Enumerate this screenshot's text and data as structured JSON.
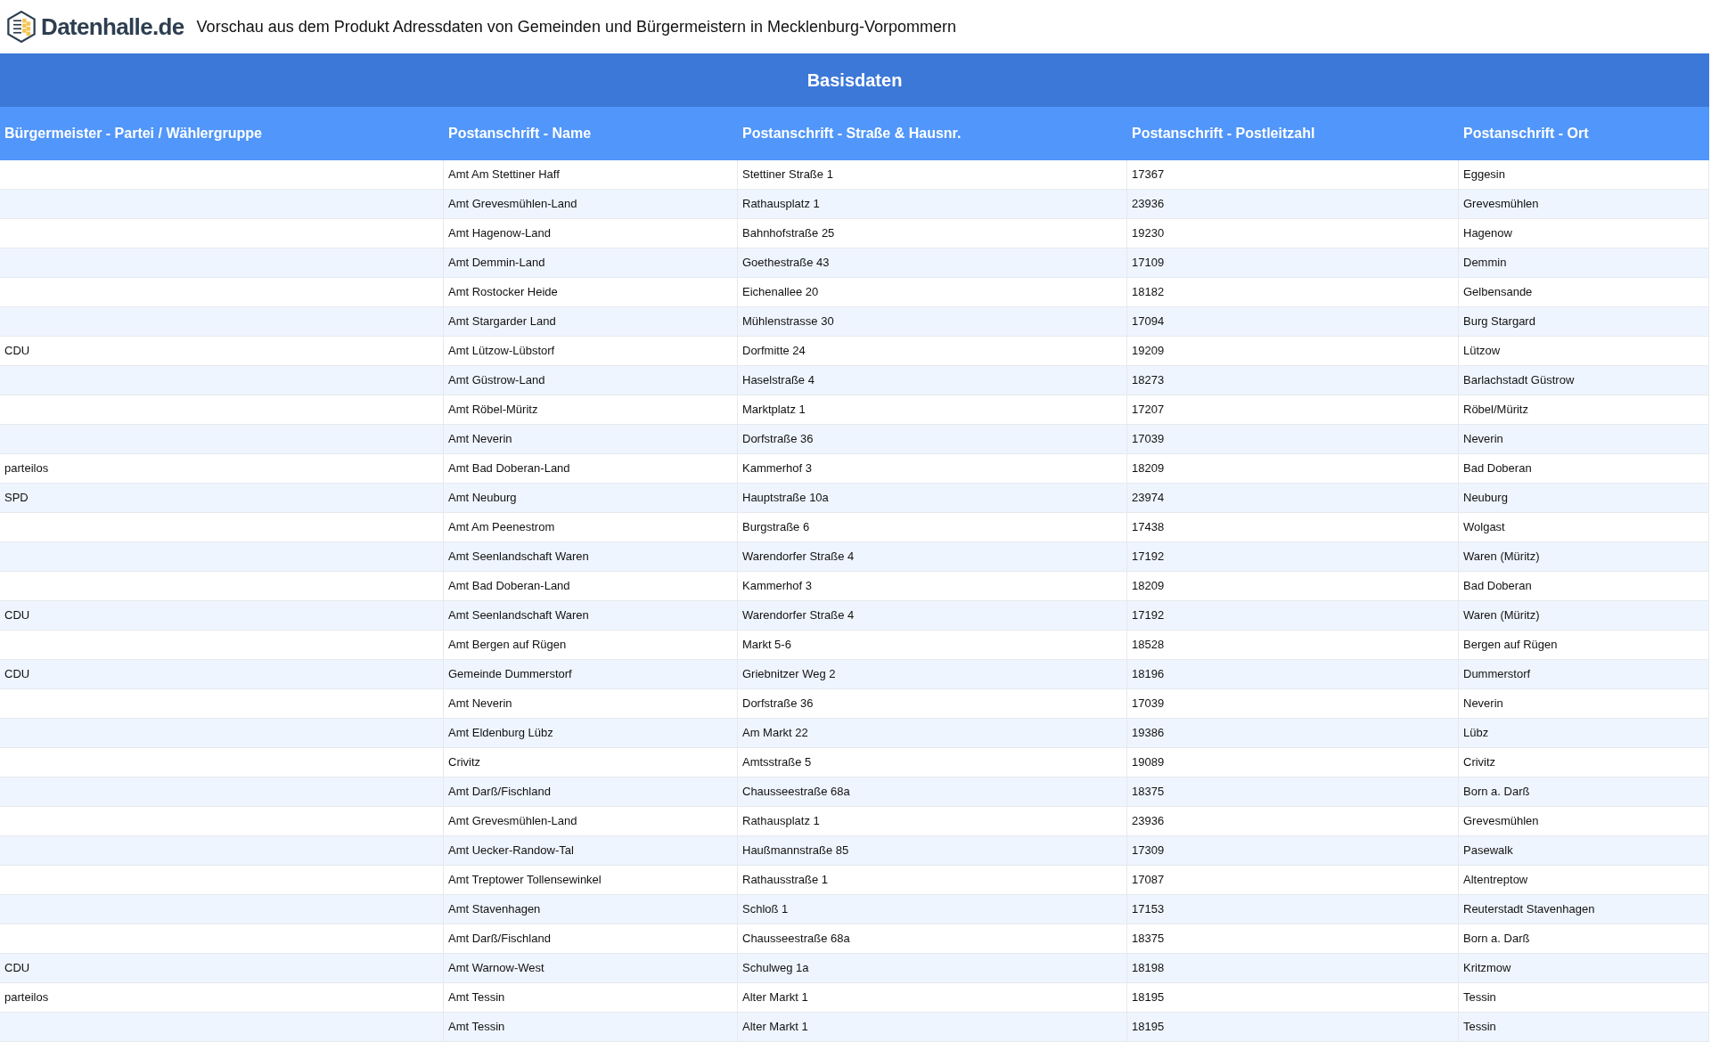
{
  "header": {
    "logo_text": "Datenhalle.de",
    "title": "Vorschau aus dem Produkt Adressdaten von Gemeinden und Bürgermeistern in Mecklenburg-Vorpommern"
  },
  "table": {
    "group_heading": "Basisdaten",
    "columns": [
      "Bürgermeister - Partei / Wählergruppe",
      "Postanschrift - Name",
      "Postanschrift - Straße & Hausnr.",
      "Postanschrift - Postleitzahl",
      "Postanschrift - Ort"
    ],
    "rows": [
      {
        "name": "Amt Am Stettiner Haff",
        "street": "Stettiner Straße 1",
        "zip": "17367",
        "city": "Eggesin"
      },
      {
        "name": "Amt Grevesmühlen-Land",
        "street": "Rathausplatz 1",
        "zip": "23936",
        "city": "Grevesmühlen"
      },
      {
        "name": "Amt Hagenow-Land",
        "street": "Bahnhofstraße 25",
        "zip": "19230",
        "city": "Hagenow"
      },
      {
        "name": "Amt Demmin-Land",
        "street": "Goethestraße 43",
        "zip": "17109",
        "city": "Demmin"
      },
      {
        "name": "Amt Rostocker Heide",
        "street": "Eichenallee 20",
        "zip": "18182",
        "city": "Gelbensande"
      },
      {
        "name": "Amt Stargarder Land",
        "street": "Mühlenstrasse 30",
        "zip": "17094",
        "city": "Burg Stargard"
      },
      {
        "party": "CDU",
        "name": "Amt Lützow-Lübstorf",
        "street": "Dorfmitte 24",
        "zip": "19209",
        "city": "Lützow"
      },
      {
        "name": "Amt Güstrow-Land",
        "street": "Haselstraße 4",
        "zip": "18273",
        "city": "Barlachstadt Güstrow"
      },
      {
        "name": "Amt Röbel-Müritz",
        "street": "Marktplatz 1",
        "zip": "17207",
        "city": "Röbel/Müritz"
      },
      {
        "name": "Amt Neverin",
        "street": "Dorfstraße 36",
        "zip": "17039",
        "city": "Neverin"
      },
      {
        "party": "parteilos",
        "name": "Amt Bad Doberan-Land",
        "street": "Kammerhof 3",
        "zip": "18209",
        "city": "Bad Doberan"
      },
      {
        "party": "SPD",
        "name": "Amt Neuburg",
        "street": "Hauptstraße 10a",
        "zip": "23974",
        "city": "Neuburg"
      },
      {
        "name": "Amt Am Peenestrom",
        "street": "Burgstraße 6",
        "zip": "17438",
        "city": "Wolgast"
      },
      {
        "name": "Amt Seenlandschaft Waren",
        "street": "Warendorfer Straße 4",
        "zip": "17192",
        "city": "Waren (Müritz)"
      },
      {
        "name": "Amt Bad Doberan-Land",
        "street": "Kammerhof 3",
        "zip": "18209",
        "city": "Bad Doberan"
      },
      {
        "party": "CDU",
        "name": "Amt Seenlandschaft Waren",
        "street": "Warendorfer Straße 4",
        "zip": "17192",
        "city": "Waren (Müritz)"
      },
      {
        "name": "Amt Bergen auf Rügen",
        "street": "Markt 5-6",
        "zip": "18528",
        "city": "Bergen auf Rügen"
      },
      {
        "party": "CDU",
        "name": "Gemeinde Dummerstorf",
        "street": "Griebnitzer Weg 2",
        "zip": "18196",
        "city": "Dummerstorf"
      },
      {
        "name": "Amt Neverin",
        "street": "Dorfstraße 36",
        "zip": "17039",
        "city": "Neverin"
      },
      {
        "name": "Amt Eldenburg Lübz",
        "street": "Am Markt 22",
        "zip": "19386",
        "city": "Lübz"
      },
      {
        "name": "Crivitz",
        "street": "Amtsstraße 5",
        "zip": "19089",
        "city": "Crivitz"
      },
      {
        "name": "Amt Darß/Fischland",
        "street": "Chausseestraße 68a",
        "zip": "18375",
        "city": "Born a. Darß"
      },
      {
        "name": "Amt Grevesmühlen-Land",
        "street": "Rathausplatz 1",
        "zip": "23936",
        "city": "Grevesmühlen"
      },
      {
        "name": "Amt Uecker-Randow-Tal",
        "street": "Haußmannstraße 85",
        "zip": "17309",
        "city": "Pasewalk"
      },
      {
        "name": "Amt Treptower Tollensewinkel",
        "street": "Rathausstraße 1",
        "zip": "17087",
        "city": "Altentreptow"
      },
      {
        "name": "Amt Stavenhagen",
        "street": "Schloß 1",
        "zip": "17153",
        "city": "Reuterstadt Stavenhagen"
      },
      {
        "name": "Amt Darß/Fischland",
        "street": "Chausseestraße 68a",
        "zip": "18375",
        "city": "Born a. Darß"
      },
      {
        "party": "CDU",
        "name": "Amt Warnow-West",
        "street": "Schulweg 1a",
        "zip": "18198",
        "city": "Kritzmow"
      },
      {
        "party": "parteilos",
        "name": "Amt Tessin",
        "street": "Alter Markt 1",
        "zip": "18195",
        "city": "Tessin"
      },
      {
        "name": "Amt Tessin",
        "street": "Alter Markt 1",
        "zip": "18195",
        "city": "Tessin"
      }
    ]
  }
}
